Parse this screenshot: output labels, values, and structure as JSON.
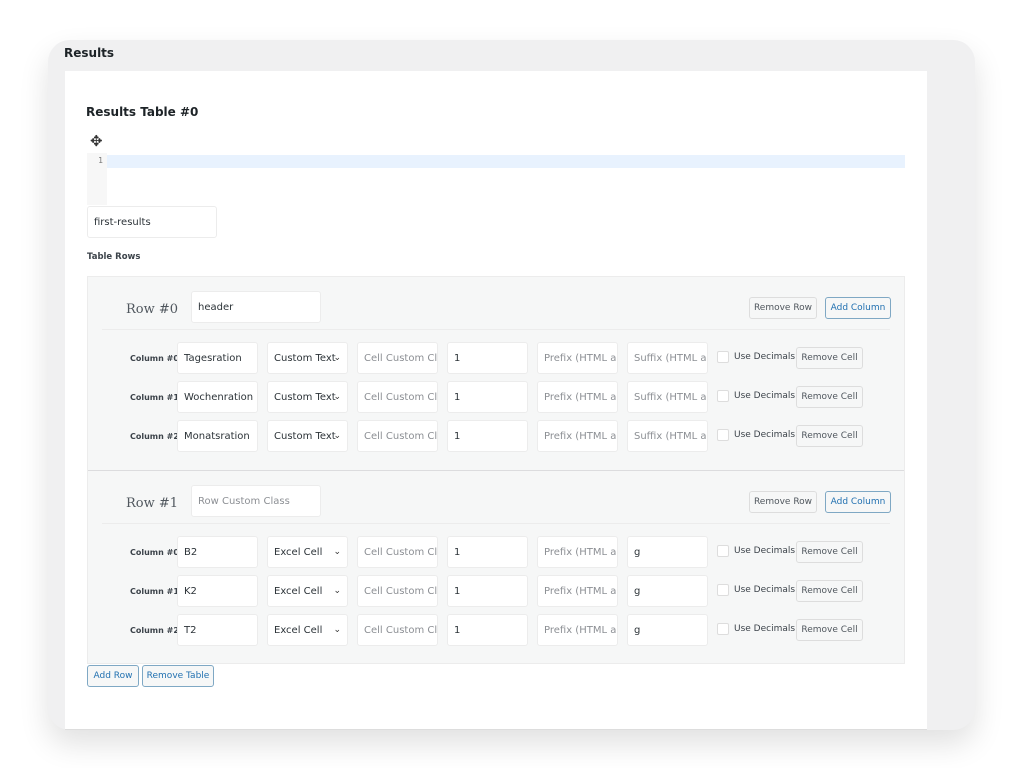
{
  "section_title": "Results",
  "table_title": "Results Table #0",
  "editor": {
    "line_number": "1"
  },
  "table_class": "first-results",
  "table_rows_label": "Table Rows",
  "rows": [
    {
      "title": "Row #0",
      "class_value": "header",
      "class_placeholder": "Row Custom Class",
      "remove_row": "Remove Row",
      "add_column": "Add Column",
      "columns": [
        {
          "label": "Column #0",
          "value": "Tagesration",
          "type": "Custom Text",
          "cell_class_placeholder": "Cell Custom Cla",
          "colspan": "1",
          "prefix_placeholder": "Prefix (HTML all",
          "suffix": "",
          "suffix_placeholder": "Suffix (HTML all",
          "use_decimals": "Use Decimals",
          "checked": false,
          "remove_cell": "Remove Cell"
        },
        {
          "label": "Column #1",
          "value": "Wochenration",
          "type": "Custom Text",
          "cell_class_placeholder": "Cell Custom Cla",
          "colspan": "1",
          "prefix_placeholder": "Prefix (HTML all",
          "suffix": "",
          "suffix_placeholder": "Suffix (HTML all",
          "use_decimals": "Use Decimals",
          "checked": false,
          "remove_cell": "Remove Cell"
        },
        {
          "label": "Column #2",
          "value": "Monatsration",
          "type": "Custom Text",
          "cell_class_placeholder": "Cell Custom Cla",
          "colspan": "1",
          "prefix_placeholder": "Prefix (HTML all",
          "suffix": "",
          "suffix_placeholder": "Suffix (HTML all",
          "use_decimals": "Use Decimals",
          "checked": false,
          "remove_cell": "Remove Cell"
        }
      ]
    },
    {
      "title": "Row #1",
      "class_value": "",
      "class_placeholder": "Row Custom Class",
      "remove_row": "Remove Row",
      "add_column": "Add Column",
      "columns": [
        {
          "label": "Column #0",
          "value": "B2",
          "type": "Excel Cell",
          "cell_class_placeholder": "Cell Custom Cla",
          "colspan": "1",
          "prefix_placeholder": "Prefix (HTML all",
          "suffix": "g",
          "suffix_placeholder": "Suffix (HTML all",
          "use_decimals": "Use Decimals",
          "checked": false,
          "remove_cell": "Remove Cell"
        },
        {
          "label": "Column #1",
          "value": "K2",
          "type": "Excel Cell",
          "cell_class_placeholder": "Cell Custom Cla",
          "colspan": "1",
          "prefix_placeholder": "Prefix (HTML all",
          "suffix": "g",
          "suffix_placeholder": "Suffix (HTML all",
          "use_decimals": "Use Decimals",
          "checked": false,
          "remove_cell": "Remove Cell"
        },
        {
          "label": "Column #2",
          "value": "T2",
          "type": "Excel Cell",
          "cell_class_placeholder": "Cell Custom Cla",
          "colspan": "1",
          "prefix_placeholder": "Prefix (HTML all",
          "suffix": "g",
          "suffix_placeholder": "Suffix (HTML all",
          "use_decimals": "Use Decimals",
          "checked": false,
          "remove_cell": "Remove Cell"
        }
      ]
    }
  ],
  "add_row": "Add Row",
  "remove_table": "Remove Table",
  "icons": {
    "move": "move-arrows-icon",
    "chevron": "chevron-down-icon"
  }
}
